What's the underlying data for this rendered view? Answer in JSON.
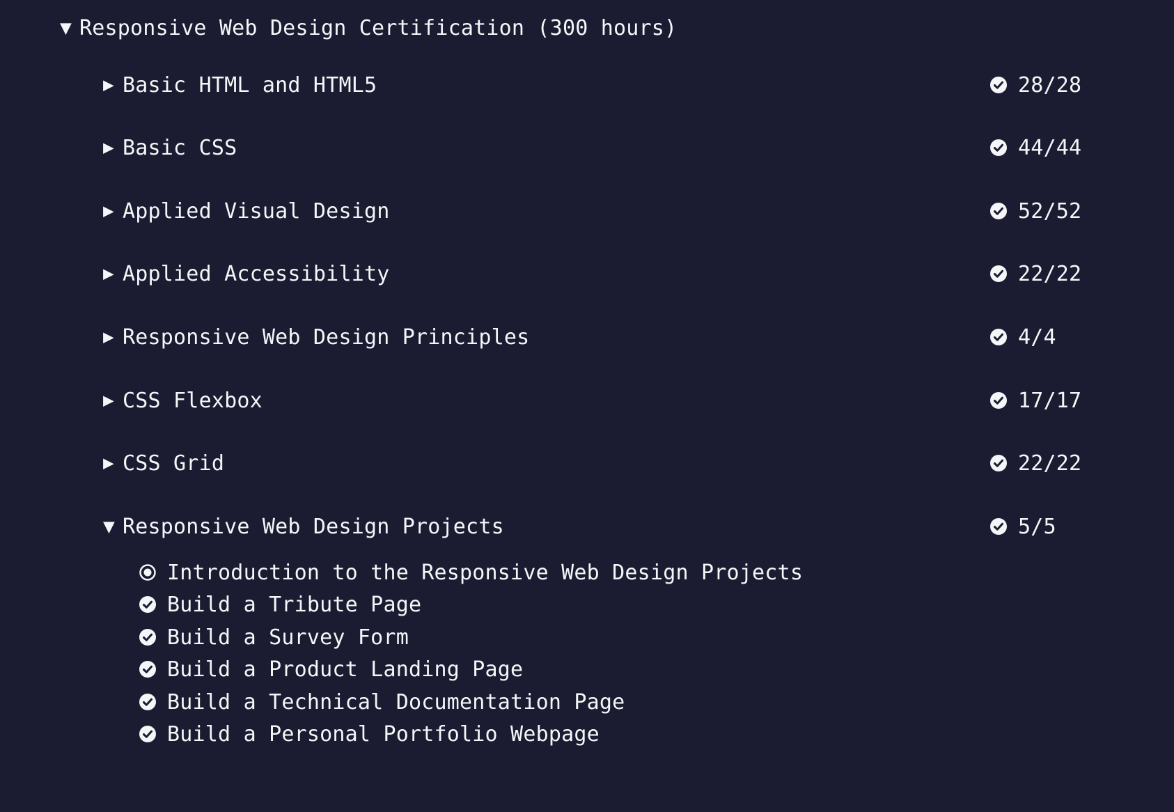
{
  "certification": {
    "title": "Responsive Web Design Certification (300 hours)",
    "expanded": true
  },
  "blocks": [
    {
      "title": "Basic HTML and HTML5",
      "progress": "28/28",
      "expanded": false,
      "complete": true
    },
    {
      "title": "Basic CSS",
      "progress": "44/44",
      "expanded": false,
      "complete": true
    },
    {
      "title": "Applied Visual Design",
      "progress": "52/52",
      "expanded": false,
      "complete": true
    },
    {
      "title": "Applied Accessibility",
      "progress": "22/22",
      "expanded": false,
      "complete": true
    },
    {
      "title": "Responsive Web Design Principles",
      "progress": "4/4",
      "expanded": false,
      "complete": true
    },
    {
      "title": "CSS Flexbox",
      "progress": "17/17",
      "expanded": false,
      "complete": true
    },
    {
      "title": "CSS Grid",
      "progress": "22/22",
      "expanded": false,
      "complete": true
    },
    {
      "title": "Responsive Web Design Projects",
      "progress": "5/5",
      "expanded": true,
      "complete": true
    }
  ],
  "project_challenges": [
    {
      "title": "Introduction to the Responsive Web Design Projects",
      "icon": "radio-dot-icon"
    },
    {
      "title": "Build a Tribute Page",
      "icon": "check-circle-icon"
    },
    {
      "title": "Build a Survey Form",
      "icon": "check-circle-icon"
    },
    {
      "title": "Build a Product Landing Page",
      "icon": "check-circle-icon"
    },
    {
      "title": "Build a Technical Documentation Page",
      "icon": "check-circle-icon"
    },
    {
      "title": "Build a Personal Portfolio Webpage",
      "icon": "check-circle-icon"
    }
  ],
  "icons": {
    "collapsed": "triangle-right-icon",
    "expanded": "triangle-down-icon",
    "complete": "check-circle-icon"
  },
  "colors": {
    "background": "#1b1b32",
    "text": "#f5f6f7"
  }
}
